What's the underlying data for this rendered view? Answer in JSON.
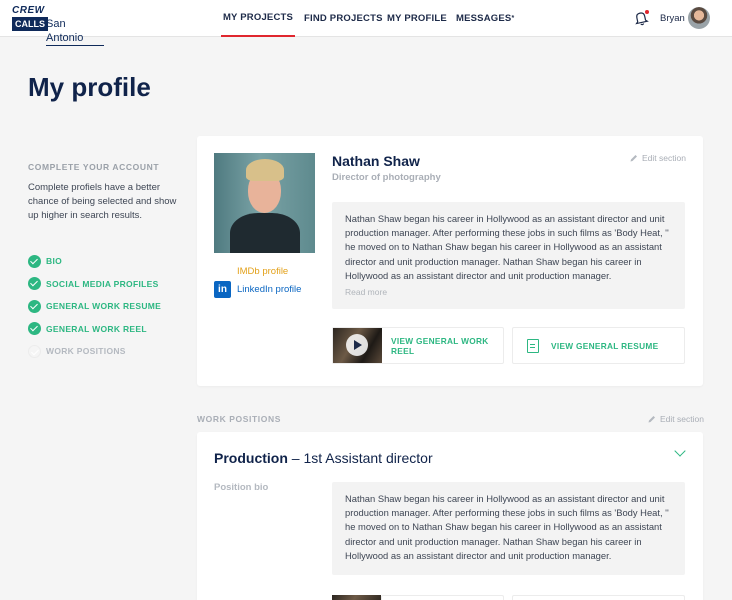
{
  "brand": {
    "crew": "CREW",
    "calls": "CALLS",
    "city": "San Antonio"
  },
  "nav": {
    "my_projects": "MY PROJECTS",
    "find_projects": "FIND PROJECTS",
    "my_profile": "MY PROFILE",
    "messages": "MESSAGES",
    "messages_marker": "*"
  },
  "user": {
    "name": "Bryan"
  },
  "page": {
    "title": "My profile"
  },
  "account": {
    "heading": "COMPLETE YOUR ACCOUNT",
    "description": "Complete profiels have a better chance of being selected and show up higher in search results.",
    "items": [
      {
        "label": "BIO",
        "done": true
      },
      {
        "label": "SOCIAL MEDIA PROFILES",
        "done": true
      },
      {
        "label": "GENERAL WORK RESUME",
        "done": true
      },
      {
        "label": "GENERAL WORK REEL",
        "done": true
      },
      {
        "label": "WORK POSITIONS",
        "done": false
      }
    ]
  },
  "profile": {
    "name": "Nathan Shaw",
    "role": "Director of photography",
    "edit_label": "Edit section",
    "imdb_label": "IMDb profile",
    "linkedin_label": "LinkedIn profile",
    "linkedin_icon": "in",
    "bio": "Nathan Shaw began his career in Hollywood as an assistant director and unit production manager. After performing these jobs in such films as 'Body Heat, '' he moved on to Nathan Shaw began his career in Hollywood as an assistant director and unit production manager. Nathan Shaw began his career in Hollywood as an assistant director and unit production manager.",
    "read_more": "Read more",
    "reel_button": "VIEW GENERAL WORK REEL",
    "resume_button": "VIEW GENERAL RESUME"
  },
  "work_positions": {
    "heading": "WORK POSITIONS",
    "edit_label": "Edit section",
    "position": {
      "department": "Production",
      "separator": " – ",
      "title": "1st Assistant director",
      "bio_label": "Position bio",
      "bio": "Nathan Shaw began his career in Hollywood as an assistant director and unit production manager. After performing these jobs in such films as 'Body Heat, '' he moved on to Nathan Shaw began his career in Hollywood as an assistant director and unit production manager. Nathan Shaw began his career in Hollywood as an assistant director and unit production manager."
    }
  },
  "colors": {
    "accent_green": "#2db782",
    "navy": "#10234a",
    "nav_active": "#e0262e",
    "imdb": "#e3a11a",
    "linkedin": "#0a66c2"
  }
}
